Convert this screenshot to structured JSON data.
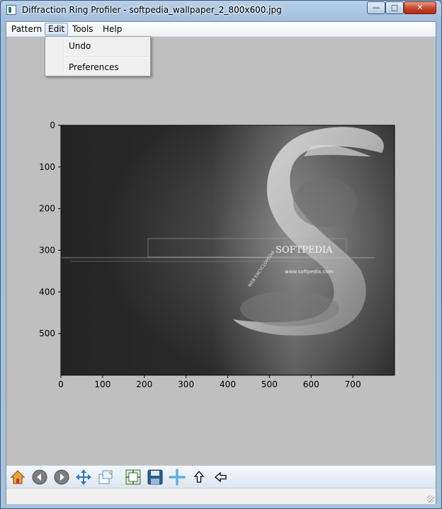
{
  "window": {
    "title": "Diffraction Ring Profiler - softpedia_wallpaper_2_800x600.jpg",
    "controls": {
      "minimize": "—",
      "maximize": "□",
      "close": "✕"
    }
  },
  "menubar": {
    "items": [
      "Pattern",
      "Edit",
      "Tools",
      "Help"
    ],
    "active": "Edit"
  },
  "edit_menu": {
    "items": [
      "Undo",
      "Preferences"
    ]
  },
  "image_view": {
    "x_ticks": [
      "0",
      "100",
      "200",
      "300",
      "400",
      "500",
      "600",
      "700"
    ],
    "y_ticks": [
      "0",
      "100",
      "200",
      "300",
      "400",
      "500"
    ],
    "xlim": [
      0,
      800
    ],
    "ylim": [
      0,
      600
    ],
    "image_text": {
      "brand": "SOFTPEDIA",
      "url": "www.softpedia.com",
      "tagline": "WEB ENCYCLOPEDIA"
    }
  },
  "toolbar": {
    "tools": [
      {
        "name": "home-icon",
        "label": "Home"
      },
      {
        "name": "back-icon",
        "label": "Back"
      },
      {
        "name": "forward-icon",
        "label": "Forward"
      },
      {
        "name": "pan-icon",
        "label": "Pan"
      },
      {
        "name": "zoom-icon",
        "label": "Zoom"
      },
      {
        "name": "subplots-icon",
        "label": "Subplots"
      },
      {
        "name": "save-icon",
        "label": "Save"
      },
      {
        "name": "crosshair-icon",
        "label": "Center"
      },
      {
        "name": "up-arrow-icon",
        "label": "Up"
      },
      {
        "name": "left-arrow-icon",
        "label": "Left"
      }
    ]
  },
  "status": {
    "text": ""
  },
  "colors": {
    "client_bg": "#bfbfbf",
    "image_dark": "#2a2a2a",
    "accent_blue": "#3b8fd0"
  }
}
